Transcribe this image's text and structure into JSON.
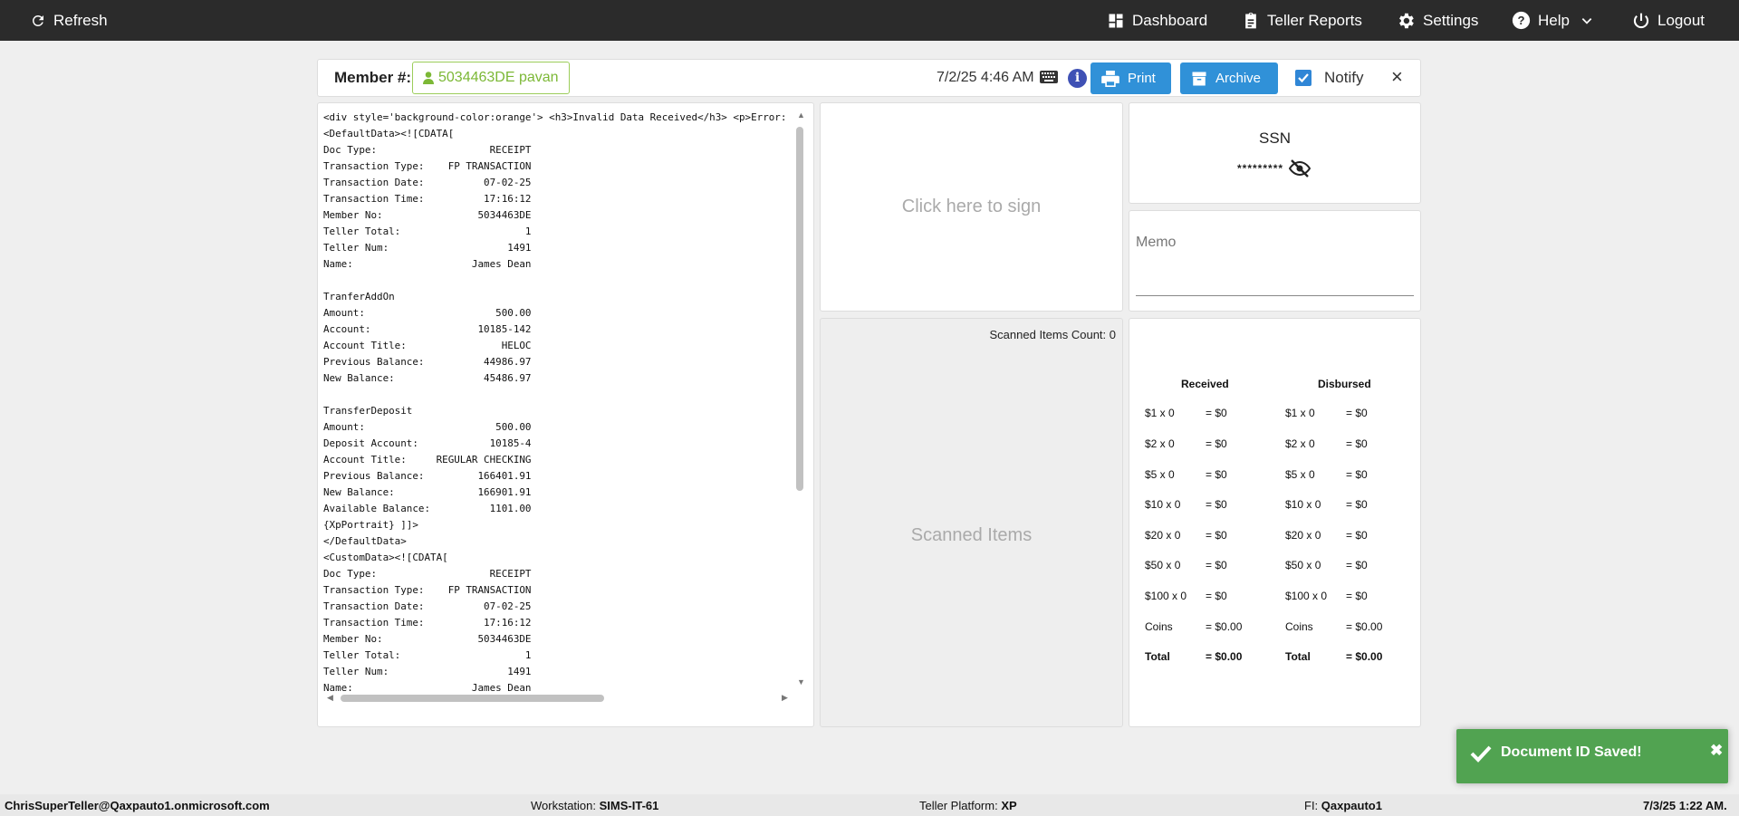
{
  "nav": {
    "refresh": "Refresh",
    "dashboard": "Dashboard",
    "teller_reports": "Teller Reports",
    "settings": "Settings",
    "help": "Help",
    "logout": "Logout"
  },
  "header": {
    "member_label": "Member #:",
    "member_value": "5034463DE pavan",
    "datetime": "7/2/25 4:46 AM",
    "print_label": "Print",
    "archive_label": "Archive",
    "notify_label": "Notify",
    "notify_checked": true,
    "close_glyph": "×"
  },
  "receipt": {
    "lines": [
      "<div style='background-color:orange'> <h3>Invalid Data Received</h3> <p>Error:",
      "<DefaultData><![CDATA[",
      "Doc Type:                   RECEIPT",
      "Transaction Type:    FP TRANSACTION",
      "Transaction Date:          07-02-25",
      "Transaction Time:          17:16:12",
      "Member No:                5034463DE",
      "Teller Total:                     1",
      "Teller Num:                    1491",
      "Name:                    James Dean",
      "",
      "TranferAddOn",
      "Amount:                      500.00",
      "Account:                  10185-142",
      "Account Title:                HELOC",
      "Previous Balance:          44986.97",
      "New Balance:               45486.97",
      "",
      "TransferDeposit",
      "Amount:                      500.00",
      "Deposit Account:            10185-4",
      "Account Title:     REGULAR CHECKING",
      "Previous Balance:         166401.91",
      "New Balance:              166901.91",
      "Available Balance:          1101.00",
      "{XpPortrait} ]]>",
      "</DefaultData>",
      "<CustomData><![CDATA[",
      "Doc Type:                   RECEIPT",
      "Transaction Type:    FP TRANSACTION",
      "Transaction Date:          07-02-25",
      "Transaction Time:          17:16:12",
      "Member No:                5034463DE",
      "Teller Total:                     1",
      "Teller Num:                    1491",
      "Name:                    James Dean"
    ]
  },
  "sign": {
    "label": "Click here to sign"
  },
  "scanned": {
    "count_label": "Scanned Items Count: 0",
    "label": "Scanned Items"
  },
  "ssn": {
    "title": "SSN",
    "masked": "*********"
  },
  "memo": {
    "label": "Memo"
  },
  "cash": {
    "received_header": "Received",
    "disbursed_header": "Disbursed",
    "received": [
      {
        "denom": "$1 x 0",
        "amount": "= $0"
      },
      {
        "denom": "$2 x 0",
        "amount": "= $0"
      },
      {
        "denom": "$5 x 0",
        "amount": "= $0"
      },
      {
        "denom": "$10 x 0",
        "amount": "= $0"
      },
      {
        "denom": "$20 x 0",
        "amount": "= $0"
      },
      {
        "denom": "$50 x 0",
        "amount": "= $0"
      },
      {
        "denom": "$100 x 0",
        "amount": "= $0"
      },
      {
        "denom": "Coins",
        "amount": "= $0.00"
      },
      {
        "denom": "Total",
        "amount": "= $0.00"
      }
    ],
    "disbursed": [
      {
        "denom": "$1 x 0",
        "amount": "= $0"
      },
      {
        "denom": "$2 x 0",
        "amount": "= $0"
      },
      {
        "denom": "$5 x 0",
        "amount": "= $0"
      },
      {
        "denom": "$10 x 0",
        "amount": "= $0"
      },
      {
        "denom": "$20 x 0",
        "amount": "= $0"
      },
      {
        "denom": "$50 x 0",
        "amount": "= $0"
      },
      {
        "denom": "$100 x 0",
        "amount": "= $0"
      },
      {
        "denom": "Coins",
        "amount": "= $0.00"
      },
      {
        "denom": "Total",
        "amount": "= $0.00"
      }
    ]
  },
  "toast": {
    "message": "Document ID Saved!",
    "close": "✖"
  },
  "footer": {
    "user": "ChrisSuperTeller@Qaxpauto1.onmicrosoft.com",
    "workstation_label": "Workstation:",
    "workstation_value": "SIMS-IT-61",
    "platform_label": "Teller Platform:",
    "platform_value": "XP",
    "fi_label": "FI:",
    "fi_value": "Qaxpauto1",
    "datetime": "7/3/25 1:22 AM."
  },
  "colors": {
    "topbar": "#2b2b2b",
    "button_blue": "#3091d8",
    "member_green": "#7cb836",
    "toast_green": "#51a351",
    "info_indigo": "#3f51b5"
  }
}
